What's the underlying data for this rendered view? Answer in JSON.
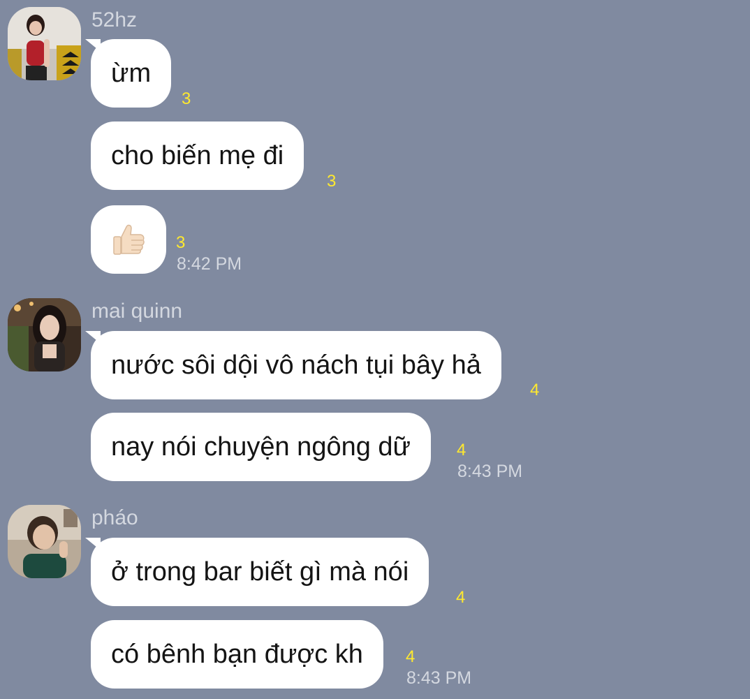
{
  "chat": {
    "groups": [
      {
        "sender": "52hz",
        "messages": [
          {
            "text": "ừm",
            "read_count": "3"
          },
          {
            "text": "cho biến mẹ đi",
            "read_count": "3"
          },
          {
            "emoji": "thumbs-up",
            "read_count": "3",
            "time": "8:42 PM"
          }
        ]
      },
      {
        "sender": "mai quinn",
        "messages": [
          {
            "text": "nước sôi dội vô nách tụi bây hả",
            "read_count": "4"
          },
          {
            "text": "nay nói chuyện ngông dữ",
            "read_count": "4",
            "time": "8:43 PM"
          }
        ]
      },
      {
        "sender": "pháo",
        "messages": [
          {
            "text": "ở trong bar biết gì mà nói",
            "read_count": "4"
          },
          {
            "text": "có bênh bạn được kh",
            "read_count": "4",
            "time": "8:43 PM"
          }
        ]
      }
    ]
  },
  "colors": {
    "background": "#808aa0",
    "bubble": "#ffffff",
    "read_count": "#ffe92e",
    "meta_text": "#d4d8e0"
  }
}
